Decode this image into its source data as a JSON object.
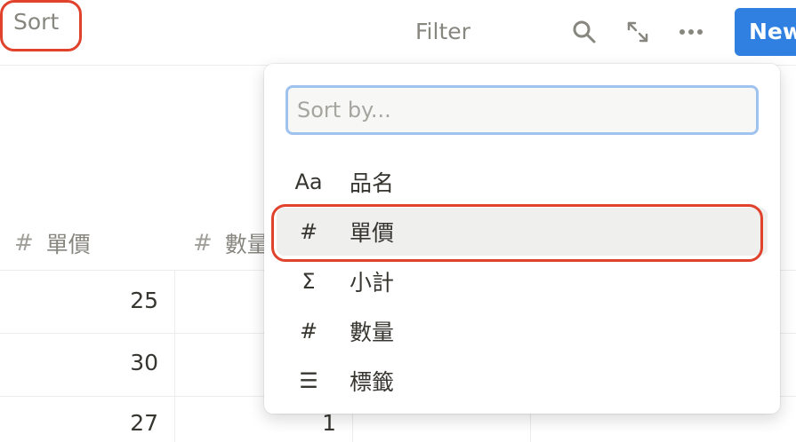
{
  "toolbar": {
    "filter_label": "Filter",
    "sort_label": "Sort",
    "search_icon": "search-icon",
    "expand_icon": "expand-icon",
    "more_icon": "more-icon",
    "new_label": "New"
  },
  "table": {
    "columns": [
      {
        "icon": "#",
        "label": "單價"
      },
      {
        "icon": "#",
        "label": "數量"
      }
    ],
    "rows": [
      {
        "price": "25",
        "qty": ""
      },
      {
        "price": "30",
        "qty": ""
      },
      {
        "price": "27",
        "qty": "1"
      }
    ]
  },
  "sort_menu": {
    "placeholder": "Sort by...",
    "items": [
      {
        "icon": "Aa",
        "icon_name": "text-property-icon",
        "label": "品名"
      },
      {
        "icon": "#",
        "icon_name": "number-property-icon",
        "label": "單價"
      },
      {
        "icon": "Σ",
        "icon_name": "formula-property-icon",
        "label": "小計"
      },
      {
        "icon": "#",
        "icon_name": "number-property-icon",
        "label": "數量"
      },
      {
        "icon": "☰",
        "icon_name": "multi-select-property-icon",
        "label": "標籤"
      }
    ]
  },
  "colors": {
    "accent": "#2f80e0",
    "annotation_red": "#e0422c",
    "input_focus": "#9fc3ee"
  }
}
